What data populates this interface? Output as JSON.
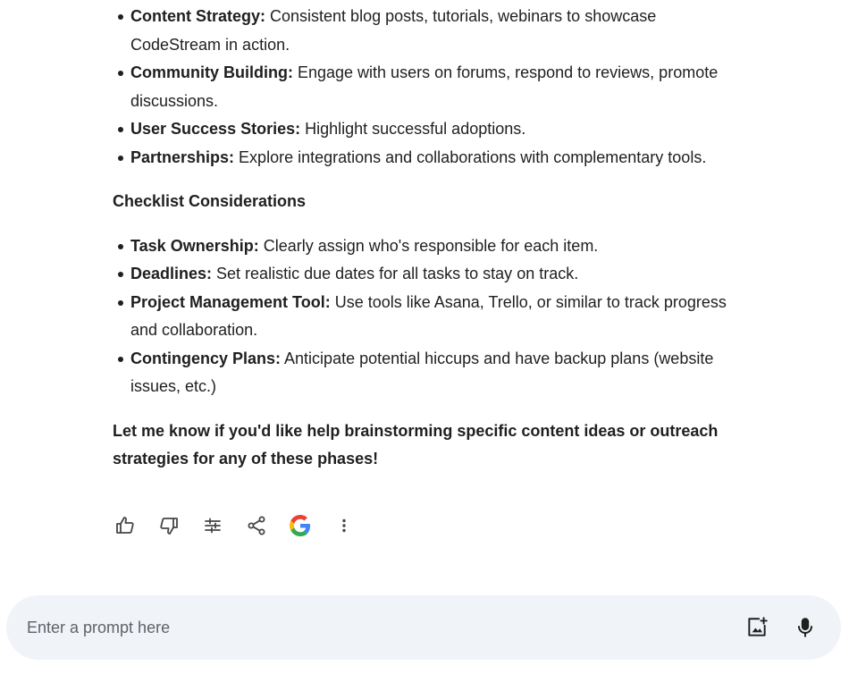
{
  "response": {
    "list1": [
      {
        "term": "Content Strategy:",
        "text": " Consistent blog posts, tutorials, webinars to showcase CodeStream in action."
      },
      {
        "term": "Community Building:",
        "text": " Engage with users on forums, respond to reviews, promote discussions."
      },
      {
        "term": "User Success Stories:",
        "text": " Highlight successful adoptions."
      },
      {
        "term": "Partnerships:",
        "text": " Explore integrations and collaborations with complementary tools."
      }
    ],
    "checklist_heading": "Checklist Considerations",
    "list2": [
      {
        "term": "Task Ownership:",
        "text": " Clearly assign who's responsible for each item."
      },
      {
        "term": "Deadlines:",
        "text": " Set realistic due dates for all tasks to stay on track."
      },
      {
        "term": "Project Management Tool:",
        "text": " Use tools like Asana, Trello, or similar to track progress and collaboration."
      },
      {
        "term": "Contingency Plans:",
        "text": " Anticipate potential hiccups and have backup plans (website issues, etc.)"
      }
    ],
    "closing": "Let me know if you'd like help brainstorming specific content ideas or outreach strategies for any of these phases!"
  },
  "actions": {
    "icons": [
      "thumbs-up-icon",
      "thumbs-down-icon",
      "modify-response-icon",
      "share-icon",
      "google-g-icon",
      "more-vert-icon"
    ]
  },
  "prompt": {
    "placeholder": "Enter a prompt here",
    "value": ""
  },
  "colors": {
    "text": "#1f1f1f",
    "icon": "#444746",
    "prompt_bg": "#f0f4f9",
    "google_blue": "#4285F4",
    "google_red": "#EA4335",
    "google_yellow": "#FBBC05",
    "google_green": "#34A853"
  }
}
